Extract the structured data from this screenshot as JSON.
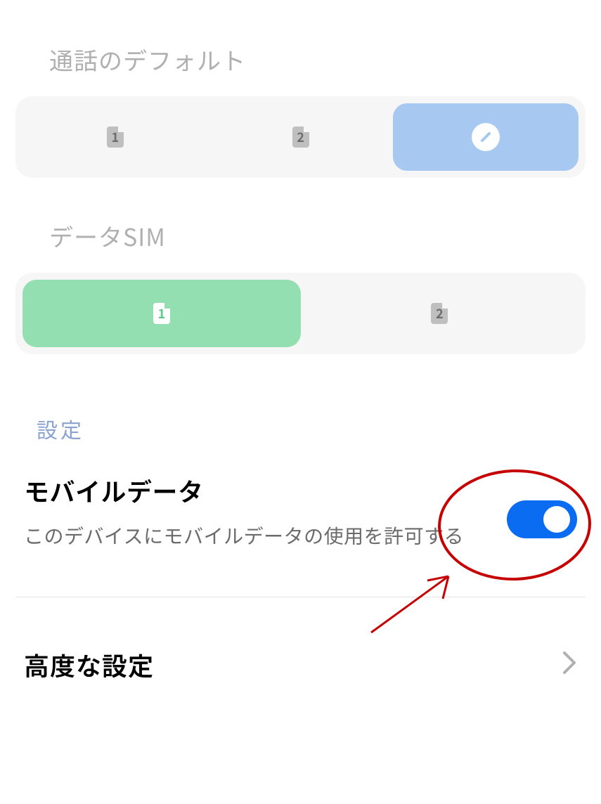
{
  "sections": {
    "call_default_title": "通話のデフォルト",
    "data_sim_title": "データSIM",
    "settings_title": "設定"
  },
  "call_default": {
    "option1": "1",
    "option2": "2",
    "selected": "edit"
  },
  "data_sim": {
    "option1": "1",
    "option2": "2",
    "selected": "1"
  },
  "mobile_data": {
    "title": "モバイルデータ",
    "description": "このデバイスにモバイルデータの使用を許可する",
    "enabled": true
  },
  "advanced": {
    "title": "高度な設定"
  },
  "annotation": {
    "target": "mobile-data-toggle",
    "type": "circle-and-arrow",
    "color": "#c60000"
  }
}
